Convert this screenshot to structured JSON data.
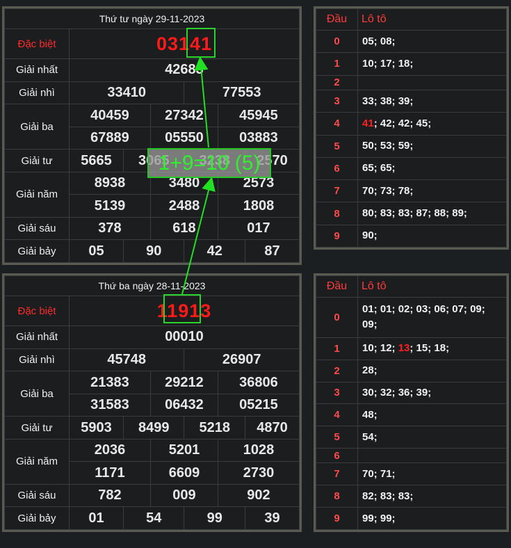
{
  "draw1": {
    "title": "Thứ tư ngày 29-11-2023",
    "dac_biet_label": "Đặc biệt",
    "dac_biet": "03141",
    "rows": [
      {
        "label": "Giải nhất",
        "values": [
          "42683"
        ]
      },
      {
        "label": "Giải nhì",
        "values": [
          "33410",
          "77553"
        ]
      },
      {
        "label": "Giải ba",
        "values": [
          "40459",
          "27342",
          "45945",
          "67889",
          "05550",
          "03883"
        ]
      },
      {
        "label": "Giải tư",
        "values": [
          "5665",
          "3065",
          "3238",
          "2570"
        ]
      },
      {
        "label": "Giải năm",
        "values": [
          "8938",
          "3480",
          "2573",
          "5139",
          "2488",
          "1808"
        ]
      },
      {
        "label": "Giải sáu",
        "values": [
          "378",
          "618",
          "017"
        ]
      },
      {
        "label": "Giải bảy",
        "values": [
          "05",
          "90",
          "42",
          "87"
        ]
      }
    ],
    "loto_header": [
      "Đầu",
      "Lô tô"
    ],
    "loto": [
      {
        "d": "0",
        "v": "05; 08;"
      },
      {
        "d": "1",
        "v": "10; 17; 18;"
      },
      {
        "d": "2",
        "v": ""
      },
      {
        "d": "3",
        "v": "33; 38; 39;"
      },
      {
        "d": "4",
        "hl": "41",
        "v": "; 42; 42; 45;"
      },
      {
        "d": "5",
        "v": "50; 53; 59;"
      },
      {
        "d": "6",
        "v": "65; 65;"
      },
      {
        "d": "7",
        "v": "70; 73; 78;"
      },
      {
        "d": "8",
        "v": "80; 83; 83; 87; 88; 89;"
      },
      {
        "d": "9",
        "v": "90;"
      }
    ]
  },
  "draw2": {
    "title": "Thứ ba ngày 28-11-2023",
    "dac_biet_label": "Đặc biệt",
    "dac_biet": "11913",
    "rows": [
      {
        "label": "Giải nhất",
        "values": [
          "00010"
        ]
      },
      {
        "label": "Giải nhì",
        "values": [
          "45748",
          "26907"
        ]
      },
      {
        "label": "Giải ba",
        "values": [
          "21383",
          "29212",
          "36806",
          "31583",
          "06432",
          "05215"
        ]
      },
      {
        "label": "Giải tư",
        "values": [
          "5903",
          "8499",
          "5218",
          "4870"
        ]
      },
      {
        "label": "Giải năm",
        "values": [
          "2036",
          "5201",
          "1028",
          "1171",
          "6609",
          "2730"
        ]
      },
      {
        "label": "Giải sáu",
        "values": [
          "782",
          "009",
          "902"
        ]
      },
      {
        "label": "Giải bảy",
        "values": [
          "01",
          "54",
          "99",
          "39"
        ]
      }
    ],
    "loto_header": [
      "Đầu",
      "Lô tô"
    ],
    "loto": [
      {
        "d": "0",
        "v": "01; 01; 02; 03; 06; 07; 09; 09;"
      },
      {
        "d": "1",
        "pre": "10; 12; ",
        "hl": "13",
        "v": "; 15; 18;"
      },
      {
        "d": "2",
        "v": "28;"
      },
      {
        "d": "3",
        "v": "30; 32; 36; 39;"
      },
      {
        "d": "4",
        "v": "48;"
      },
      {
        "d": "5",
        "v": "54;"
      },
      {
        "d": "6",
        "v": ""
      },
      {
        "d": "7",
        "v": "70; 71;"
      },
      {
        "d": "8",
        "v": "82; 83; 83;"
      },
      {
        "d": "9",
        "v": "99; 99;"
      }
    ]
  },
  "overlay_text": "1+9=10 (5)",
  "colors": {
    "accent_red": "#ff1a1a",
    "highlight_green": "#2bd42b",
    "border": "#5b5a52"
  }
}
